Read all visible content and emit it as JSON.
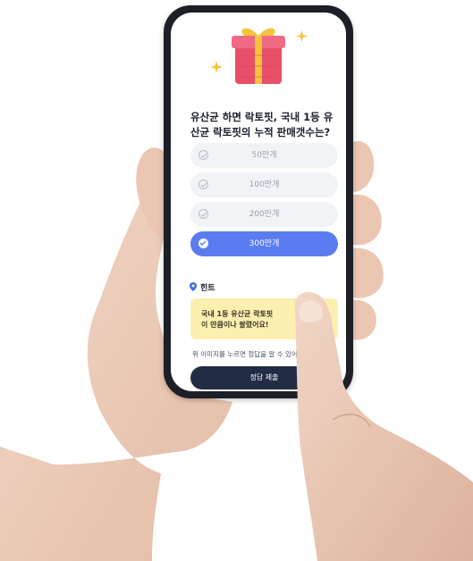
{
  "quiz": {
    "question": "유산균 하면 락토핏, 국내 1등 유산균 락토핏의 누적 판매갯수는?",
    "options": [
      {
        "label": "50만개",
        "selected": false
      },
      {
        "label": "100만개",
        "selected": false
      },
      {
        "label": "200만개",
        "selected": false
      },
      {
        "label": "300만개",
        "selected": true
      }
    ]
  },
  "hint": {
    "title": "힌트",
    "card_line1": "국내 1등 유산균 락토핏",
    "card_line2": "이 만큼이나 팔렸어요!",
    "description": "위 이미지를 누르면 정답을 알 수 있어요!"
  },
  "submit_label": "정답 제출",
  "icons": {
    "gift": "gift-icon",
    "sparkle": "sparkle-icon",
    "check": "check-icon",
    "location_pin": "location-pin-icon"
  },
  "colors": {
    "accent": "#5b7cf0",
    "submit_bg": "#232c45",
    "hint_bg": "#fcf0b0",
    "option_bg": "#f1f3f7",
    "pin": "#3f6be8"
  }
}
